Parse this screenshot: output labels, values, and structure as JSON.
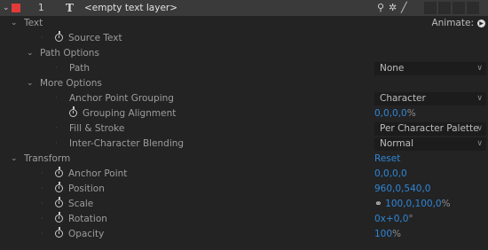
{
  "layer": {
    "twirl": "⌄",
    "label_color": "#e33a3a",
    "number": "1",
    "type_icon": "T",
    "name": "<empty text layer>"
  },
  "text_group": {
    "label": "Text",
    "animate_label": "Animate:",
    "animate_icon": "play-circle-icon",
    "source_text": "Source Text",
    "path_options": {
      "label": "Path Options",
      "path_label": "Path",
      "path_value": "None"
    },
    "more_options": {
      "label": "More Options",
      "anchor_point_grouping": {
        "label": "Anchor Point Grouping",
        "value": "Character"
      },
      "grouping_alignment": {
        "label": "Grouping Alignment",
        "value": "0,0,0,0",
        "unit": "%"
      },
      "fill_stroke": {
        "label": "Fill & Stroke",
        "value": "Per Character Palette"
      },
      "inter_character_blending": {
        "label": "Inter-Character Blending",
        "value": "Normal"
      }
    }
  },
  "transform": {
    "label": "Transform",
    "reset_label": "Reset",
    "anchor_point": {
      "label": "Anchor Point",
      "value": "0,0,0,0"
    },
    "position": {
      "label": "Position",
      "value": "960,0,540,0"
    },
    "scale": {
      "label": "Scale",
      "value": "100,0,100,0",
      "unit": "%"
    },
    "rotation": {
      "label": "Rotation",
      "value": "0x+0,0",
      "unit": "°"
    },
    "opacity": {
      "label": "Opacity",
      "value": "100",
      "unit": "%"
    }
  },
  "colors": {
    "accent_blue": "#2f86d6",
    "background": "#232323",
    "layer_bar": "#3a3a3a"
  }
}
